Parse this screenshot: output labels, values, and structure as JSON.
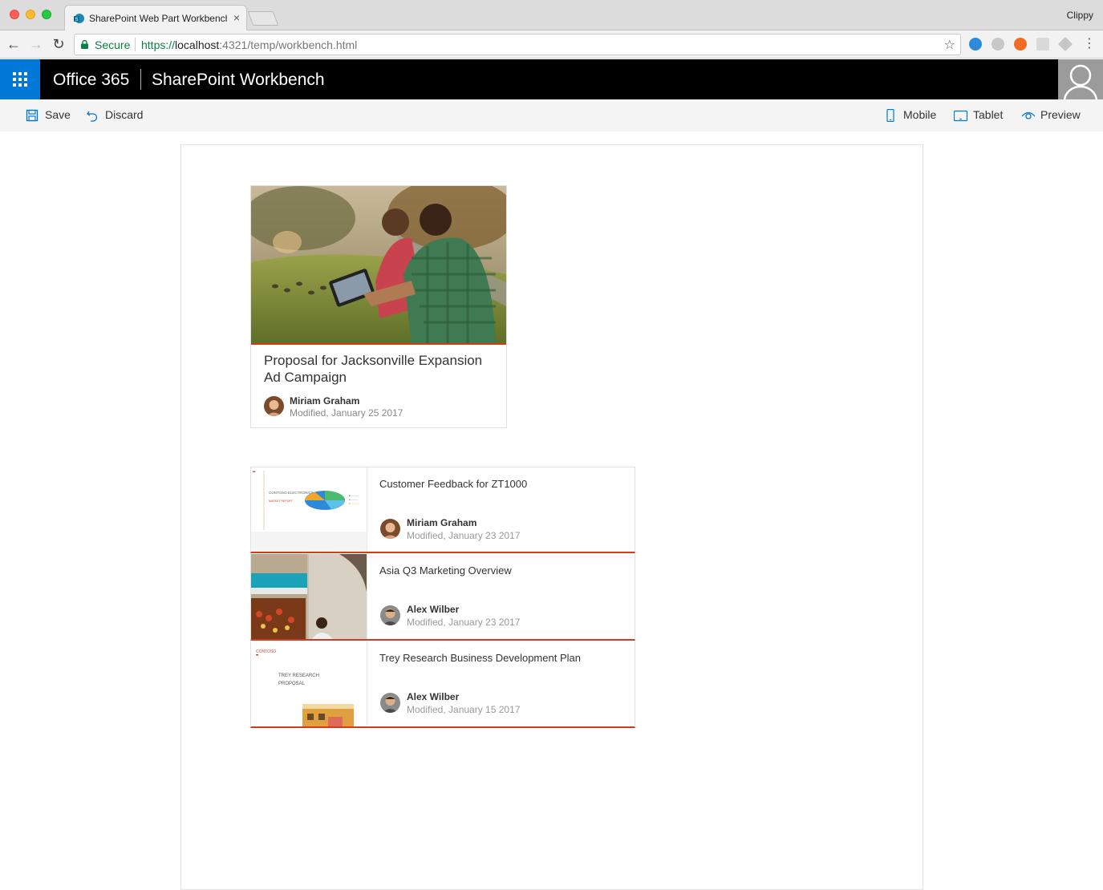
{
  "browser": {
    "tab_title": "SharePoint Web Part Workbench",
    "tab_close": "×",
    "profile_name": "Clippy",
    "secure_label": "Secure",
    "url_scheme": "https://",
    "url_host": "localhost",
    "url_rest": ":4321/temp/workbench.html",
    "star": "☆",
    "menu": "⋮",
    "back": "←",
    "forward": "→",
    "reload": "↻"
  },
  "suite": {
    "brand": "Office 365",
    "app_title": "SharePoint Workbench",
    "accent": "#0078d7"
  },
  "commands": {
    "save": "Save",
    "discard": "Discard",
    "mobile": "Mobile",
    "tablet": "Tablet",
    "preview": "Preview"
  },
  "document_card": {
    "title": "Proposal for Jacksonville Expansion Ad Campaign",
    "author": "Miriam Graham",
    "modified": "Modified, January 25 2017",
    "accent": "#d13c1b"
  },
  "compact_cards": [
    {
      "title": "Customer Feedback for ZT1000",
      "author": "Miriam Graham",
      "modified": "Modified, January 23 2017"
    },
    {
      "title": "Asia Q3 Marketing Overview",
      "author": "Alex Wilber",
      "modified": "Modified, January 23 2017"
    },
    {
      "title": "Trey Research Business Development Plan",
      "author": "Alex Wilber",
      "modified": "Modified, January 15 2017"
    }
  ],
  "thumb_text": {
    "contoso_electronics": "CONTOSO ELECTRONICS",
    "market_report": "MARKET REPORT",
    "trey_research_proposal": "TREY RESEARCH PROPOSAL",
    "contoso": "CONTOSO"
  }
}
